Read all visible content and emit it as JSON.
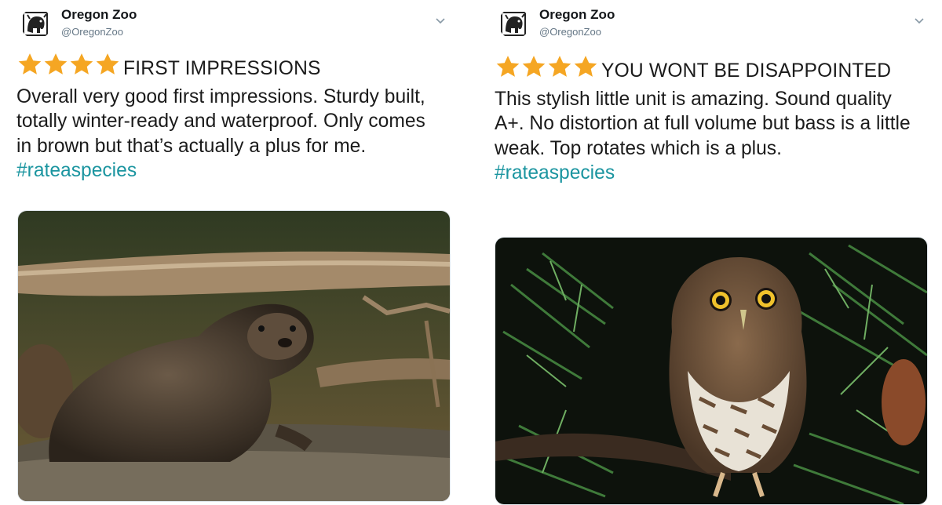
{
  "tweets": [
    {
      "account_name": "Oregon Zoo",
      "handle": "@OregonZoo",
      "rating_stars": 4,
      "headline": "FIRST IMPRESSIONS",
      "body": "Overall very good first impressions. Sturdy built, totally winter-ready and waterproof. Only comes in brown but that’s actually a plus for me.",
      "hashtag": "#rateaspecies",
      "photo_subject": "river otter on rocks"
    },
    {
      "account_name": "Oregon Zoo",
      "handle": "@OregonZoo",
      "rating_stars": 4,
      "headline": "YOU WONT BE DISAPPOINTED",
      "body": "This stylish little unit is amazing. Sound quality A+. No distortion at full volume but bass is a little weak. Top rotates which is a plus.",
      "hashtag": "#rateaspecies",
      "photo_subject": "pygmy owl on pine branch"
    }
  ],
  "colors": {
    "star": "#f5a623",
    "hashtag": "#1b95a0",
    "name": "#14171a",
    "handle": "#657786"
  },
  "icons": {
    "avatar": "oregon-zoo-elephant-logo",
    "caret": "chevron-down-icon",
    "star": "star-icon"
  }
}
